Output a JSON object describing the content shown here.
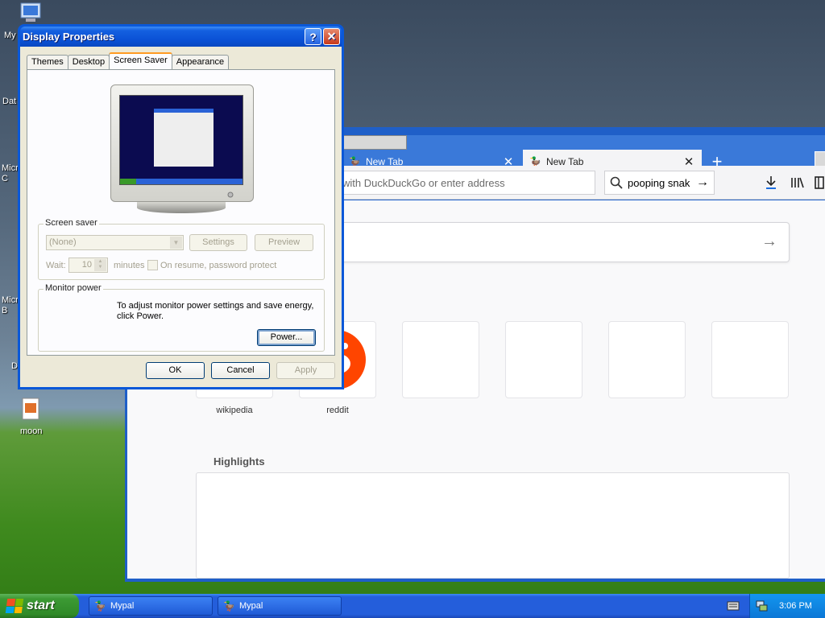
{
  "desktop": {
    "icons": [
      {
        "label": "My"
      },
      {
        "label": "Dat"
      },
      {
        "label": "Micro C"
      },
      {
        "label": "Micro B"
      },
      {
        "label": "D"
      },
      {
        "label": "moon"
      }
    ]
  },
  "browser": {
    "tabs": [
      {
        "label": "New Tab",
        "close": "✕"
      },
      {
        "label": "New Tab",
        "close": "✕"
      }
    ],
    "new_tab": "+",
    "url_placeholder": "with DuckDuckGo or enter address",
    "search_value": "pooping snak",
    "go_arrow": "→",
    "toolbar_icons": [
      "download-icon",
      "library-icon",
      "sidebar-icon"
    ],
    "tiles": [
      {
        "label": "wikipedia"
      },
      {
        "label": "reddit"
      },
      {
        "label": ""
      },
      {
        "label": ""
      },
      {
        "label": ""
      },
      {
        "label": ""
      }
    ],
    "highlights_title": "Highlights"
  },
  "dialog": {
    "title": "Display Properties",
    "help_button": "?",
    "close_button": "✕",
    "tabs": [
      "Themes",
      "Desktop",
      "Screen Saver",
      "Appearance"
    ],
    "active_tab": "Screen Saver",
    "screen_saver": {
      "group_label": "Screen saver",
      "selected": "(None)",
      "settings_label": "Settings",
      "preview_label": "Preview",
      "wait_label": "Wait:",
      "wait_value": "10",
      "minutes_label": "minutes",
      "resume_label": "On resume, password protect"
    },
    "monitor_power": {
      "group_label": "Monitor power",
      "description": "To adjust monitor power settings and save energy, click Power.",
      "power_button": "Power..."
    },
    "buttons": {
      "ok": "OK",
      "cancel": "Cancel",
      "apply": "Apply"
    }
  },
  "taskbar": {
    "start_label": "start",
    "tasks": [
      {
        "label": "Mypal"
      },
      {
        "label": "Mypal"
      }
    ],
    "clock": "3:06 PM"
  },
  "colors": {
    "xp_blue": "#245edb",
    "start_green": "#3c9a34",
    "reddit_orange": "#ff4500",
    "tab_accent": "#ff9b22"
  }
}
